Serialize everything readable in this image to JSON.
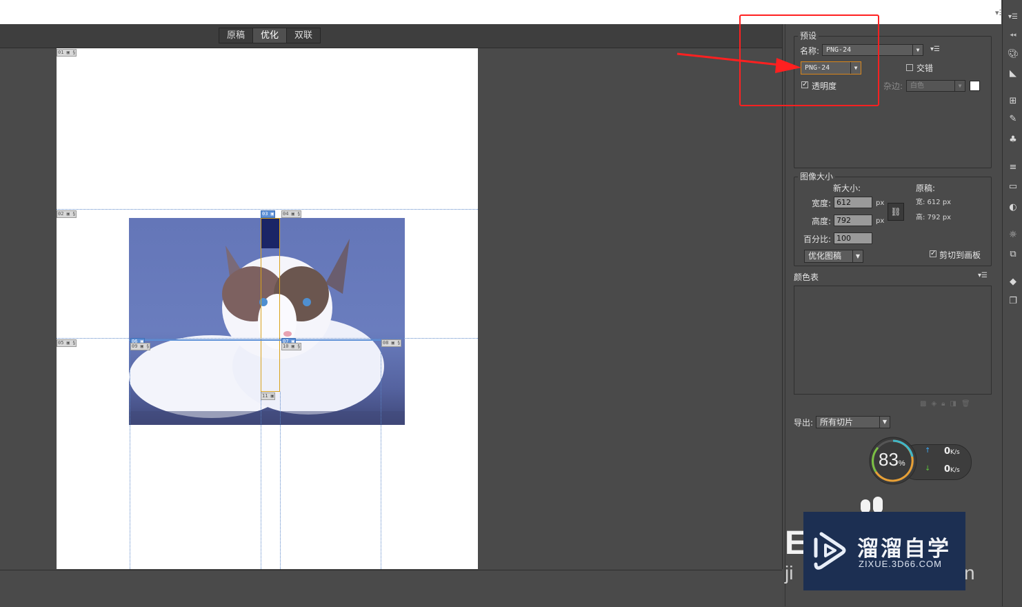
{
  "view_tabs": [
    "原稿",
    "优化",
    "双联"
  ],
  "active_tab": "优化",
  "slices": {
    "s01": "01",
    "s02": "02",
    "s03": "03",
    "s04": "04",
    "s05": "05",
    "s06": "06",
    "s07": "07",
    "s08": "08",
    "s09": "09",
    "s10": "10",
    "s11": "11"
  },
  "preset": {
    "title": "预设",
    "name_label": "名称:",
    "name_value": "PNG-24",
    "format_value": "PNG-24",
    "interlaced_label": "交错",
    "interlaced_checked": false,
    "transparency_label": "透明度",
    "transparency_checked": true,
    "matte_label": "杂边:",
    "matte_value": "白色"
  },
  "image_size": {
    "title": "图像大小",
    "new_size_label": "新大小:",
    "original_label": "原稿:",
    "width_label": "宽度:",
    "width_value": "612",
    "height_label": "高度:",
    "height_value": "792",
    "unit": "px",
    "percent_label": "百分比:",
    "percent_value": "100",
    "orig_width": "宽: 612 px",
    "orig_height": "高: 792 px",
    "quality_value": "优化图稿",
    "clip_label": "剪切到画板",
    "clip_checked": true
  },
  "color_table": {
    "title": "颜色表"
  },
  "export": {
    "label": "导出:",
    "value": "所有切片"
  },
  "speed_widget": {
    "percent": "83",
    "percent_sign": "%",
    "upload": "0",
    "download": "0",
    "unit": "K/s"
  },
  "watermark": {
    "brand": "溜溜自学",
    "url": "ZIXUE.3D66.COM"
  },
  "colors": {
    "annotation": "#ff2020",
    "panel_bg": "#4a4a4a",
    "focus_border": "#d9861b"
  }
}
